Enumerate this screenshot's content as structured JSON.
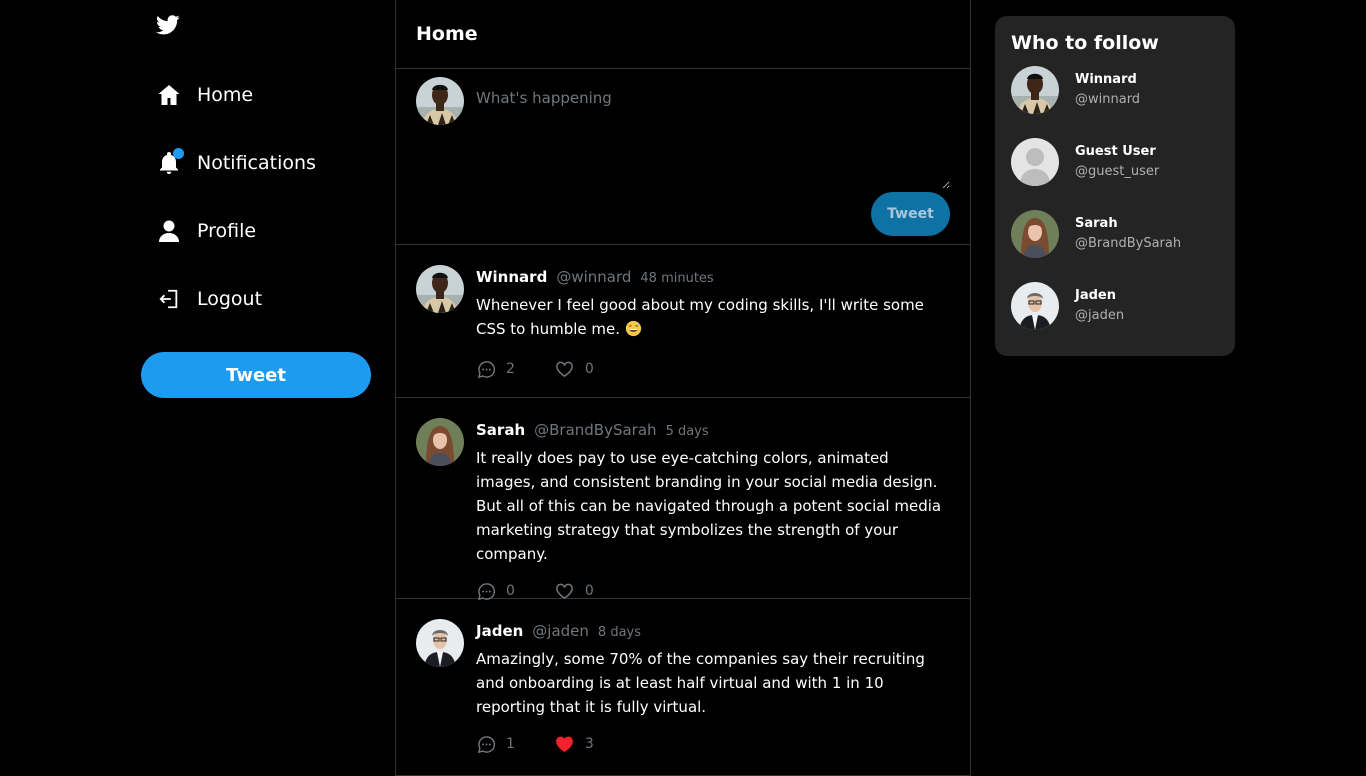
{
  "colors": {
    "accent": "#1d9bf0",
    "background": "#000000",
    "panel": "#242424",
    "like_red": "#f4212e",
    "muted": "#71767b"
  },
  "sidebar": {
    "logo_icon": "twitter-bird-icon",
    "items": [
      {
        "label": "Home",
        "icon": "home-icon"
      },
      {
        "label": "Notifications",
        "icon": "bell-icon",
        "has_unread": true
      },
      {
        "label": "Profile",
        "icon": "user-icon"
      },
      {
        "label": "Logout",
        "icon": "logout-icon"
      }
    ],
    "tweet_button": "Tweet"
  },
  "feed": {
    "title": "Home",
    "composer": {
      "placeholder": "What's happening",
      "tweet_button": "Tweet"
    },
    "tweets": [
      {
        "name": "Winnard",
        "handle": "@winnard",
        "time": "48 minutes",
        "text": "Whenever I feel good about my coding skills, I'll write some CSS to humble me.",
        "emoji": "grinning-sweat-emoji",
        "replies": "2",
        "likes": "0",
        "liked": false
      },
      {
        "name": "Sarah",
        "handle": "@BrandBySarah",
        "time": "5 days",
        "text": "It really does pay to use eye-catching colors, animated images, and consistent branding in your social media design. But all of this can be navigated through a potent social media marketing strategy that symbolizes the strength of your company.",
        "replies": "0",
        "likes": "0",
        "liked": false
      },
      {
        "name": "Jaden",
        "handle": "@jaden",
        "time": "8 days",
        "text": "Amazingly, some 70% of the companies say their recruiting and onboarding is at least half virtual and with 1 in 10 reporting that it is fully virtual.",
        "replies": "1",
        "likes": "3",
        "liked": true
      }
    ]
  },
  "who_to_follow": {
    "title": "Who to follow",
    "users": [
      {
        "name": "Winnard",
        "handle": "@winnard"
      },
      {
        "name": "Guest User",
        "handle": "@guest_user"
      },
      {
        "name": "Sarah",
        "handle": "@BrandBySarah"
      },
      {
        "name": "Jaden",
        "handle": "@jaden"
      }
    ]
  }
}
